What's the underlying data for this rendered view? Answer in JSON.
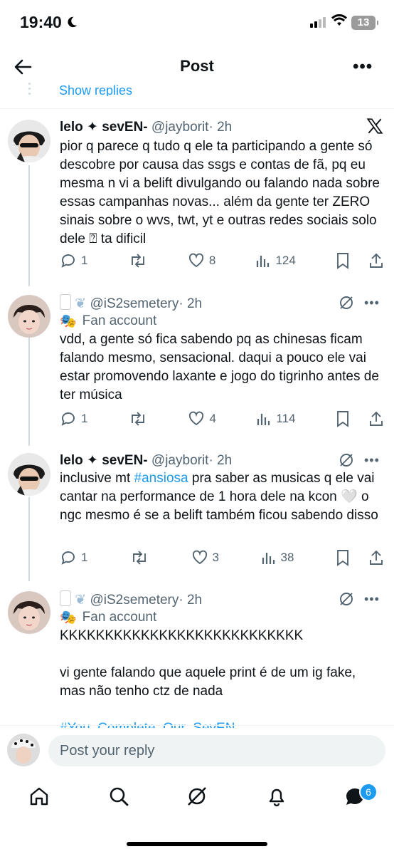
{
  "status": {
    "time": "19:40",
    "battery": "13"
  },
  "header": {
    "title": "Post"
  },
  "show_replies": "Show replies",
  "tweets": [
    {
      "name": "lelo ✦ sevEN-",
      "handle": "@jayborit",
      "time": "· 2h",
      "text": "pior q parece q tudo q ele ta participando a gente só descobre por causa das ssgs e contas de fã, pq eu mesma n vi a belift divulgando ou falando nada sobre essas campanhas novas... além da gente ter ZERO sinais sobre o wvs, twt, yt e outras redes sociais solo dele ⍰ ta dificil",
      "replies": "1",
      "likes": "8",
      "views": "124"
    },
    {
      "name": "",
      "handle": "@iS2semetery",
      "time": "· 2h",
      "fan_label": "Fan account",
      "text": "vdd, a gente só fica sabendo pq as chinesas ficam falando mesmo, sensacional. daqui a pouco ele vai estar promovendo laxante e jogo do tigrinho antes de ter música",
      "replies": "1",
      "likes": "4",
      "views": "114"
    },
    {
      "name": "lelo ✦ sevEN-",
      "handle": "@jayborit",
      "time": "· 2h",
      "text_before": "inclusive mt ",
      "hashtag": "#ansiosa",
      "text_after": " pra saber as musicas q ele vai cantar na performance de 1 hora dele na kcon 🤍 o ngc mesmo é se a belift também ficou sabendo disso",
      "replies": "1",
      "likes": "3",
      "views": "38"
    },
    {
      "name": "",
      "handle": "@iS2semetery",
      "time": "· 2h",
      "fan_label": "Fan account",
      "line1": "KKKKKKKKKKKKKKKKKKKKKKKKKKK",
      "line2": "vi gente falando que aquele print é de um ig fake, mas não tenho ctz de nada",
      "hashtag_cut": "#You_Complete_Our_SevEN"
    }
  ],
  "reply_bar": {
    "placeholder": "Post your reply"
  },
  "tabbar": {
    "badge": "6"
  }
}
